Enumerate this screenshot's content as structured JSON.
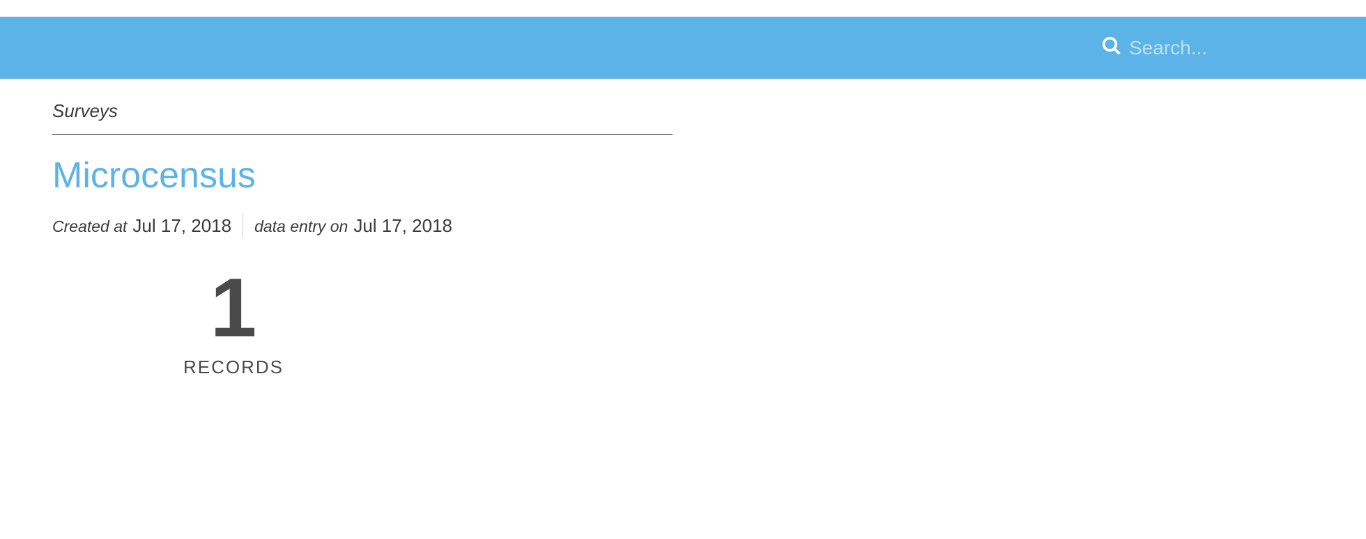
{
  "header": {
    "search_placeholder": "Search..."
  },
  "breadcrumb": "Surveys",
  "page": {
    "title": "Microcensus",
    "created_label": "Created at",
    "created_value": "Jul 17, 2018",
    "data_entry_label": "data entry on",
    "data_entry_value": "Jul 17, 2018"
  },
  "records": {
    "count": "1",
    "label": "RECORDS"
  }
}
